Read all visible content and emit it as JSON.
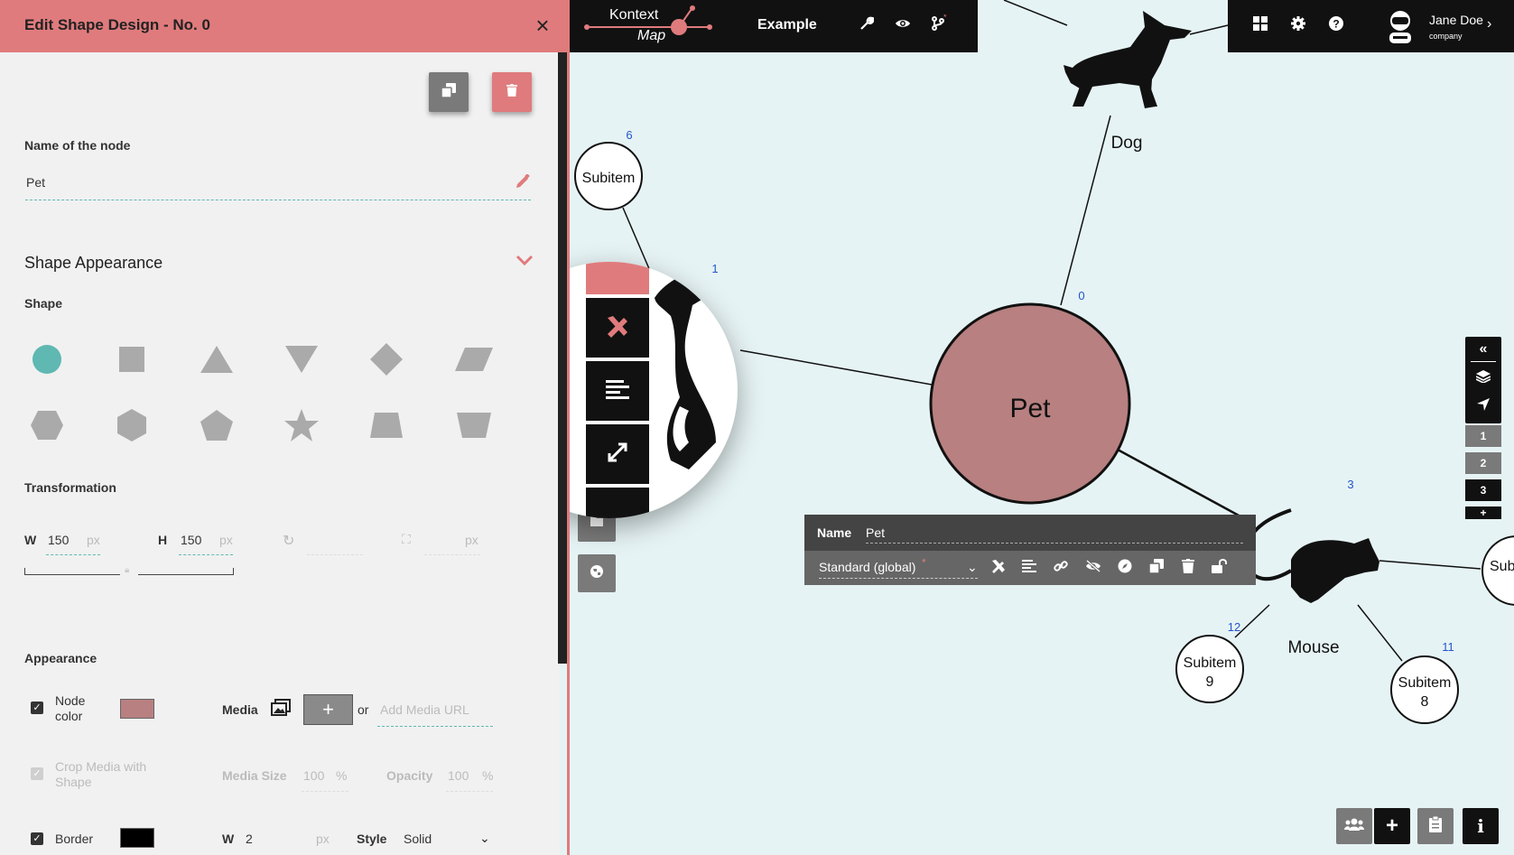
{
  "panel": {
    "title": "Edit Shape Design - No. 0",
    "name_label": "Name of the node",
    "name_value": "Pet",
    "section_title": "Shape Appearance",
    "shape_label": "Shape",
    "transformation_label": "Transformation",
    "w_label": "W",
    "w_value": "150",
    "h_label": "H",
    "h_value": "150",
    "px": "px",
    "appearance_label": "Appearance",
    "node_color_label": "Node color",
    "node_color": "#b88080",
    "media_label": "Media",
    "or_label": "or",
    "media_url_placeholder": "Add Media URL",
    "crop_media_label": "Crop Media with Shape",
    "media_size_label": "Media Size",
    "media_size_value": "100",
    "opacity_label": "Opacity",
    "opacity_value": "100",
    "percent": "%",
    "border_label": "Border",
    "border_w_label": "W",
    "border_w_value": "2",
    "border_style_label": "Style",
    "border_style_value": "Solid"
  },
  "topbar": {
    "logo_line1": "Kontext",
    "logo_line2": "Map",
    "map_title": "Example"
  },
  "user": {
    "name": "Jane Doe",
    "company": "company"
  },
  "layers": [
    "1",
    "2",
    "3",
    "+"
  ],
  "canvas": {
    "nodes": {
      "pet": "Pet",
      "dog": "Dog",
      "mouse": "Mouse",
      "subitem_top": "Subitem",
      "subitem9_line1": "Subitem",
      "subitem9_line2": "9",
      "subitem8_line1": "Subitem",
      "subitem8_line2": "8",
      "sub_right": "Sub"
    },
    "numbers": {
      "pet": "0",
      "cat": "1",
      "subitem_top": "6",
      "mouse": "3",
      "subitem9": "12",
      "subitem8": "11"
    }
  },
  "node_toolbar": {
    "name_label": "Name",
    "name_value": "Pet",
    "design_select": "Standard (global)"
  },
  "colors": {
    "accent": "#e07b7d",
    "pet_fill": "#b88080",
    "canvas_bg": "#e6f3f4",
    "teal": "#5fb8b2",
    "number_blue": "#2255cc"
  }
}
